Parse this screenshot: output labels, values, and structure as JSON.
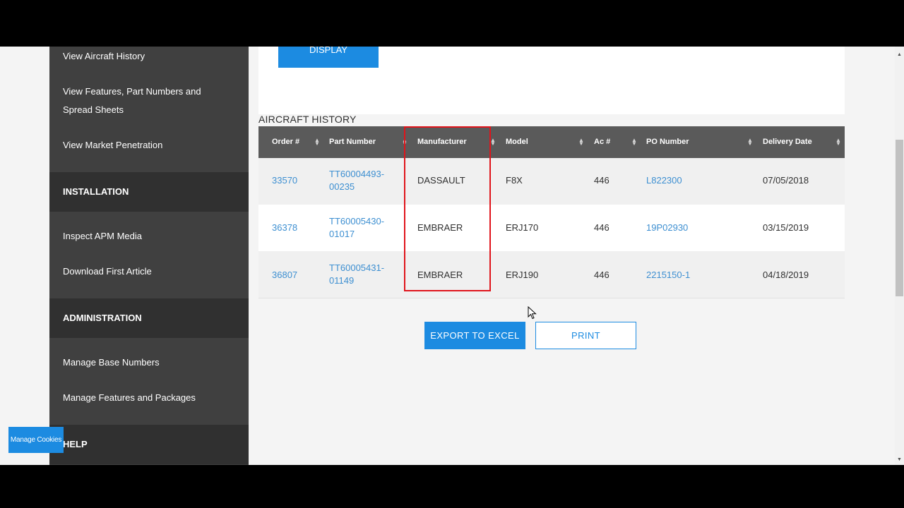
{
  "sidebar": {
    "links_top": [
      "View Aircraft History",
      "View Features, Part Numbers and",
      "Spread Sheets",
      "View Market Penetration"
    ],
    "installation_heading": "INSTALLATION",
    "installation_links": [
      "Inspect APM Media",
      "Download First Article"
    ],
    "administration_heading": "ADMINISTRATION",
    "administration_links": [
      "Manage Base Numbers",
      "Manage Features and Packages"
    ],
    "help_heading": "HELP"
  },
  "display_button": "DISPLAY",
  "section_title": "AIRCRAFT HISTORY",
  "table": {
    "columns": [
      "Order #",
      "Part Number",
      "Manufacturer",
      "Model",
      "Ac #",
      "PO Number",
      "Delivery Date"
    ],
    "rows": [
      {
        "order": "33570",
        "part_line1": "TT60004493-",
        "part_line2": "00235",
        "manufacturer": "DASSAULT",
        "model": "F8X",
        "ac": "446",
        "po": "L822300",
        "delivery": "07/05/2018"
      },
      {
        "order": "36378",
        "part_line1": "TT60005430-",
        "part_line2": "01017",
        "manufacturer": "EMBRAER",
        "model": "ERJ170",
        "ac": "446",
        "po": "19P02930",
        "delivery": "03/15/2019"
      },
      {
        "order": "36807",
        "part_line1": "TT60005431-",
        "part_line2": "01149",
        "manufacturer": "EMBRAER",
        "model": "ERJ190",
        "ac": "446",
        "po": "2215150-1",
        "delivery": "04/18/2019"
      }
    ]
  },
  "buttons": {
    "export": "EXPORT TO EXCEL",
    "print": "PRINT"
  },
  "cookies_button": "Manage Cookies",
  "colors": {
    "accent": "#1c8be1",
    "highlight": "#e0141b",
    "sidebar": "#404040",
    "header": "#5a5a5a"
  }
}
